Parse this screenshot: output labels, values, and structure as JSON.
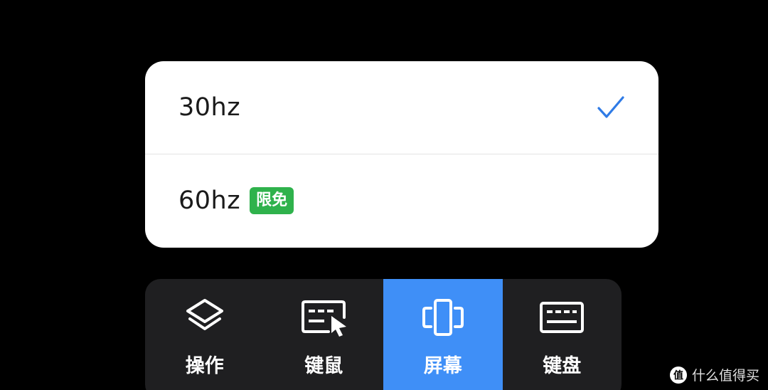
{
  "popup": {
    "options": [
      {
        "label": "30hz",
        "selected": true
      },
      {
        "label": "60hz",
        "badge": "限免"
      }
    ]
  },
  "toolbar": {
    "items": [
      {
        "label": "操作",
        "icon": "layers-icon"
      },
      {
        "label": "键鼠",
        "icon": "keyboard-mouse-icon"
      },
      {
        "label": "屏幕",
        "icon": "screen-rotate-icon",
        "active": true
      },
      {
        "label": "键盘",
        "icon": "keyboard-icon"
      }
    ]
  },
  "watermark": {
    "text": "什么值得买",
    "logo_char": "值"
  },
  "colors": {
    "background": "#000000",
    "popup_bg": "#ffffff",
    "check": "#2f7be6",
    "badge": "#2fb24c",
    "toolbar_bg": "#1f1f21",
    "active_tab": "#3f8ff7"
  }
}
